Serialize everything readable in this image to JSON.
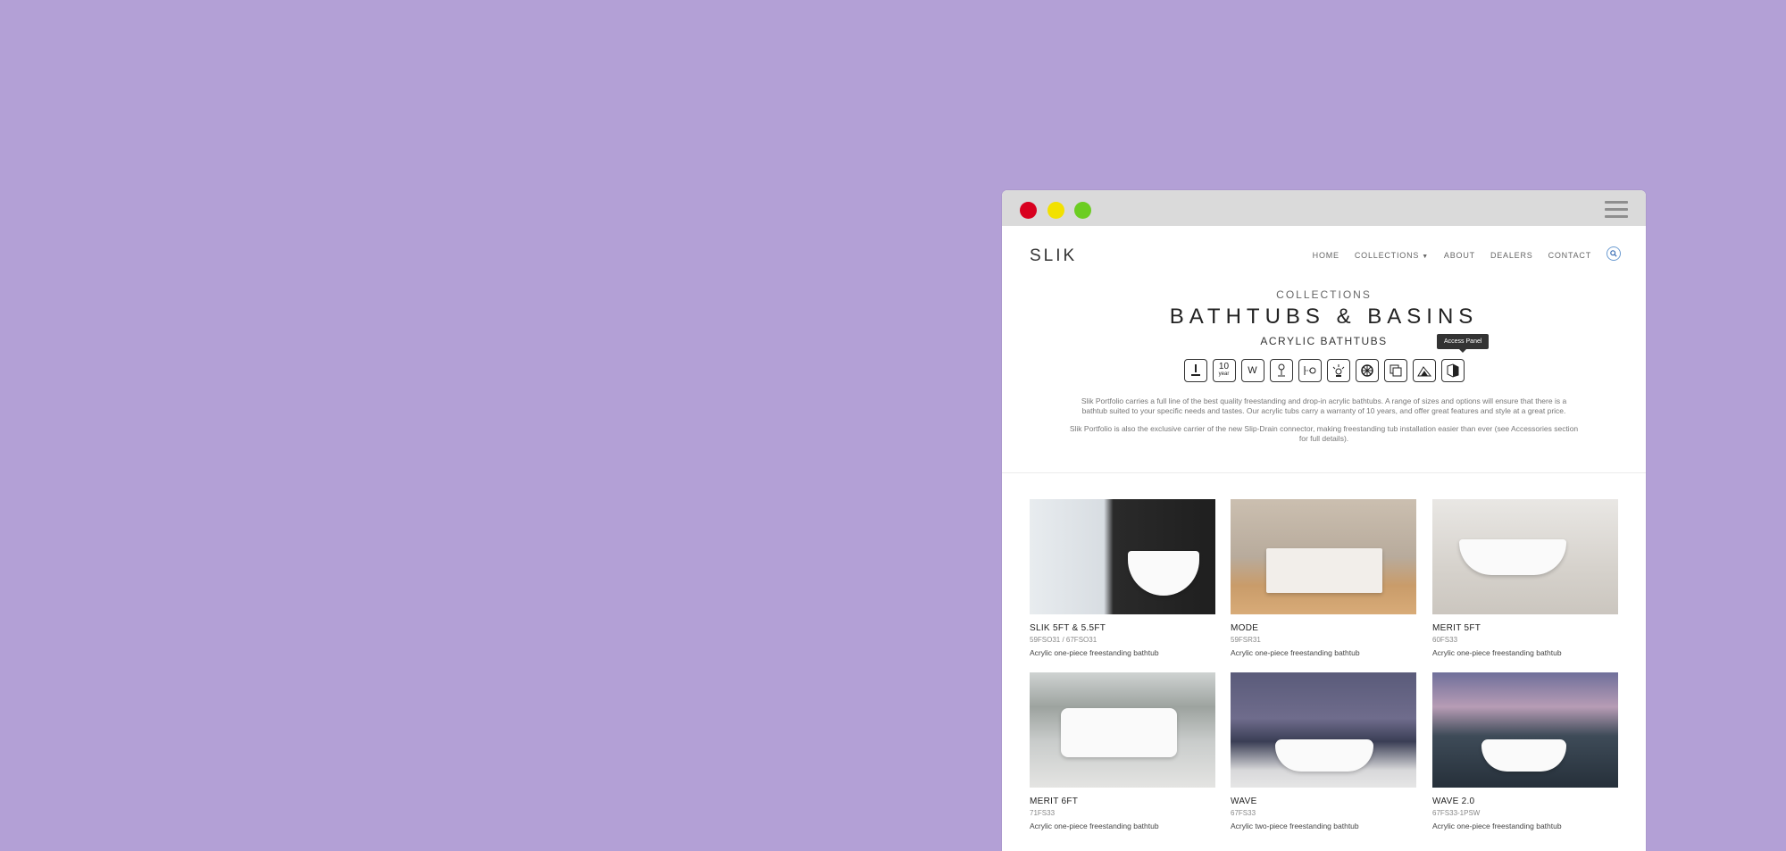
{
  "window": {
    "controls": [
      "close",
      "minimize",
      "maximize"
    ],
    "menu_icon": "hamburger-menu-icon"
  },
  "site": {
    "logo": "SLIK",
    "nav": [
      {
        "label": "HOME"
      },
      {
        "label": "COLLECTIONS",
        "has_dropdown": true
      },
      {
        "label": "ABOUT"
      },
      {
        "label": "DEALERS"
      },
      {
        "label": "CONTACT"
      }
    ],
    "search_icon": "search-icon"
  },
  "hero": {
    "collections_label": "COLLECTIONS",
    "title": "BATHTUBS & BASINS",
    "subtitle": "ACRYLIC BATHTUBS",
    "tooltip": "Access Panel"
  },
  "features": [
    {
      "icon": "freestanding-icon"
    },
    {
      "icon": "warranty-icon",
      "text": "10",
      "subtext": "year"
    },
    {
      "icon": "w-icon",
      "text": "W"
    },
    {
      "icon": "drain-icon"
    },
    {
      "icon": "overflow-icon"
    },
    {
      "icon": "light-icon"
    },
    {
      "icon": "jet-icon"
    },
    {
      "icon": "double-icon"
    },
    {
      "icon": "slope-icon"
    },
    {
      "icon": "access-panel-icon"
    }
  ],
  "description": [
    "Slik Portfolio carries a full line of the best quality freestanding and drop-in acrylic bathtubs. A range of sizes and options will ensure that there is a bathtub suited to your specific needs and tastes. Our acrylic tubs carry a warranty of 10 years, and offer great features and style at a great price.",
    "Slik Portfolio is also the exclusive carrier of the new Slip-Drain connector, making freestanding tub installation easier than ever (see Accessories section for full details)."
  ],
  "products": [
    {
      "name": "SLIK 5FT & 5.5FT",
      "code": "59FSO31 / 67FSO31",
      "desc": "Acrylic one-piece freestanding bathtub"
    },
    {
      "name": "MODE",
      "code": "59FSR31",
      "desc": "Acrylic one-piece freestanding bathtub"
    },
    {
      "name": "MERIT 5FT",
      "code": "60FS33",
      "desc": "Acrylic one-piece freestanding bathtub"
    },
    {
      "name": "MERIT 6FT",
      "code": "71FS33",
      "desc": "Acrylic one-piece freestanding bathtub"
    },
    {
      "name": "WAVE",
      "code": "67FS33",
      "desc": "Acrylic two-piece freestanding bathtub"
    },
    {
      "name": "WAVE 2.0",
      "code": "67FS33-1PSW",
      "desc": "Acrylic one-piece freestanding bathtub"
    }
  ]
}
